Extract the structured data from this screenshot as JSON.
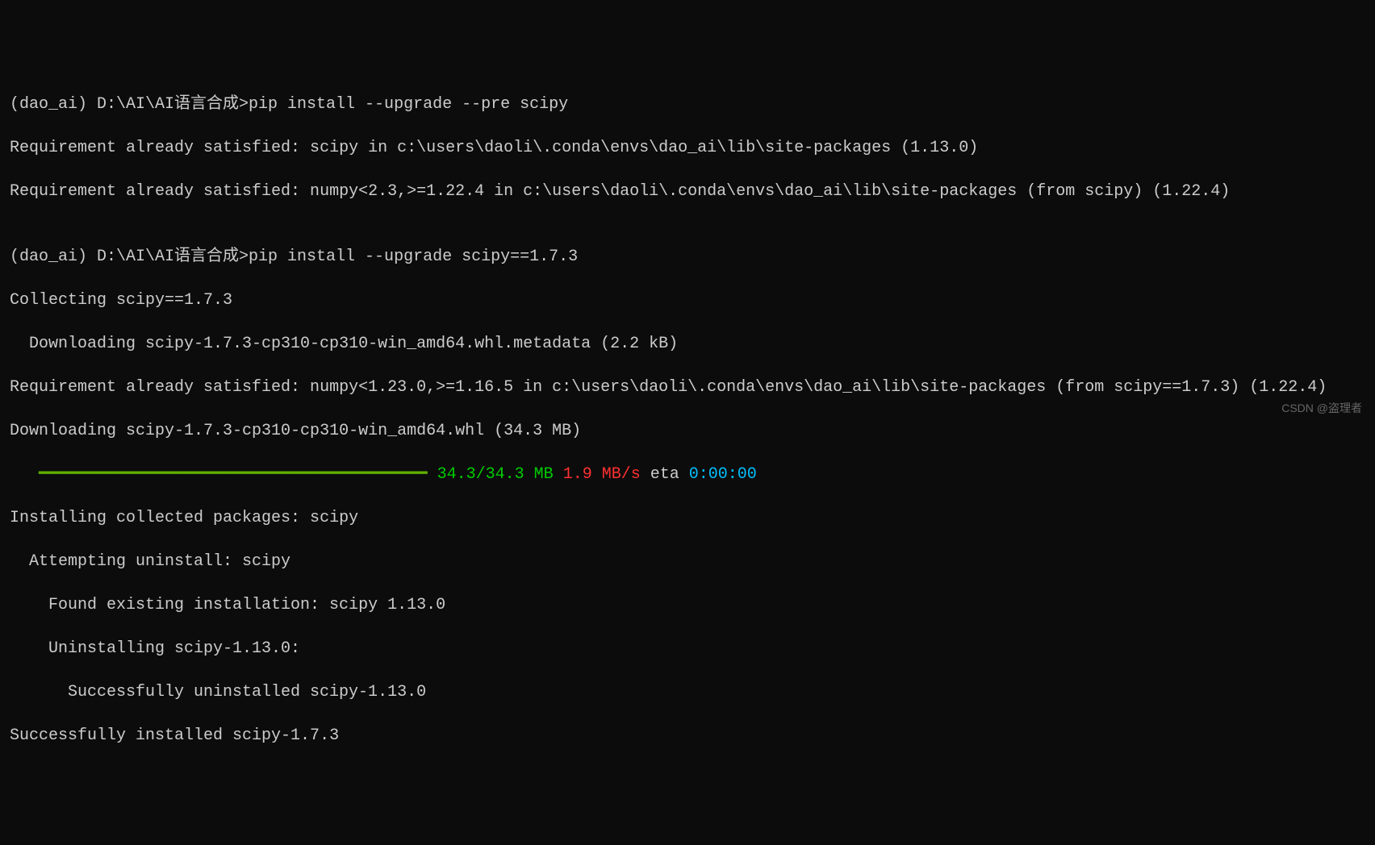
{
  "lines": {
    "prompt1": "(dao_ai) D:\\AI\\AI语言合成>pip install --upgrade --pre scipy",
    "req1": "Requirement already satisfied: scipy in c:\\users\\daoli\\.conda\\envs\\dao_ai\\lib\\site-packages (1.13.0)",
    "req2": "Requirement already satisfied: numpy<2.3,>=1.22.4 in c:\\users\\daoli\\.conda\\envs\\dao_ai\\lib\\site-packages (from scipy) (1.22.4)",
    "blank": "",
    "prompt2": "(dao_ai) D:\\AI\\AI语言合成>pip install --upgrade scipy==1.7.3",
    "collecting": "Collecting scipy==1.7.3",
    "downloading_meta": "Downloading scipy-1.7.3-cp310-cp310-win_amd64.whl.metadata (2.2 kB)",
    "req3": "Requirement already satisfied: numpy<1.23.0,>=1.16.5 in c:\\users\\daoli\\.conda\\envs\\dao_ai\\lib\\site-packages (from scipy==1.7.3) (1.22.4)",
    "downloading_whl": "Downloading scipy-1.7.3-cp310-cp310-win_amd64.whl (34.3 MB)",
    "progress": {
      "bar": "   ━━━━━━━━━━━━━━━━━━━━━━━━━━━━━━━━━━━━━━━━",
      "complete": " 34.3/34.3 MB",
      "speed": " 1.9 MB/s",
      "eta_label": " eta ",
      "eta_value": "0:00:00"
    },
    "installing": "Installing collected packages: scipy",
    "attempting": "Attempting uninstall: scipy",
    "found": "Found existing installation: scipy 1.13.0",
    "uninstalling": "Uninstalling scipy-1.13.0:",
    "success_uninstall": "Successfully uninstalled scipy-1.13.0",
    "success_install": "Successfully installed scipy-1.7.3"
  },
  "watermark": "CSDN @盗理者"
}
